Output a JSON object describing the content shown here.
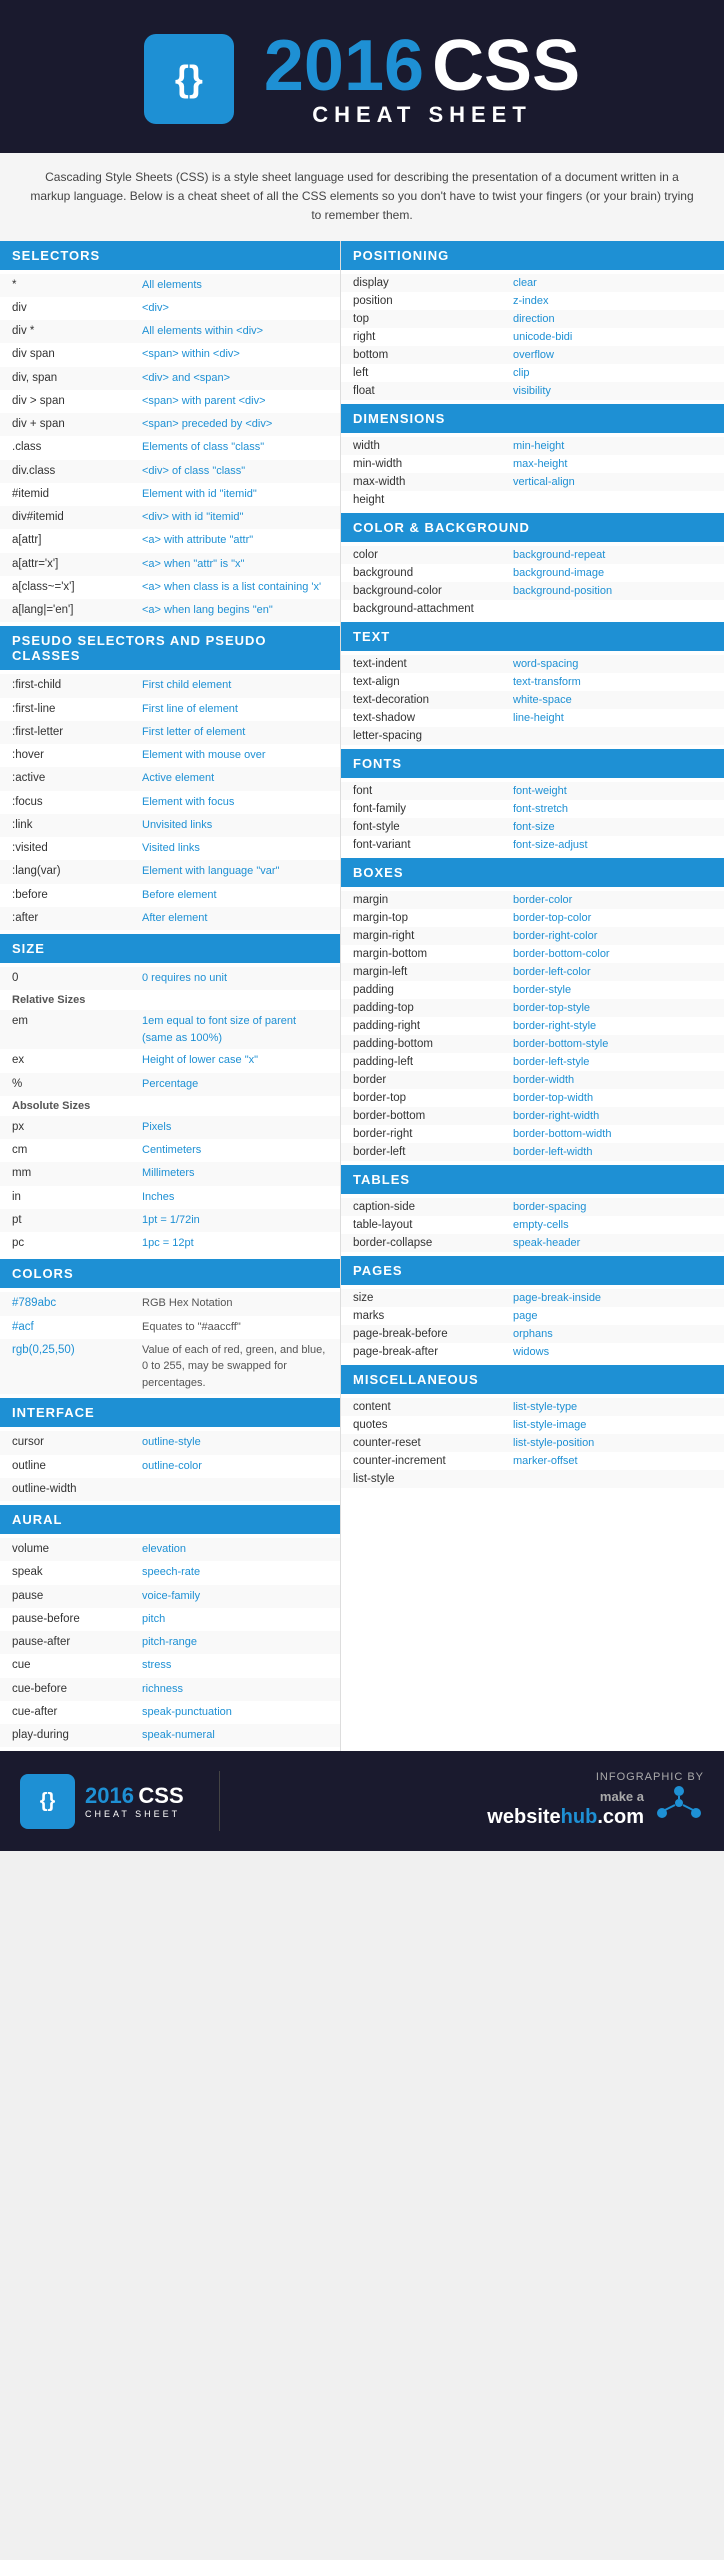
{
  "header": {
    "year": "2016",
    "css": "CSS",
    "subtitle": "CHEAT SHEET",
    "logo_symbol": "{}",
    "description": "Cascading Style Sheets (CSS) is a style sheet language used for describing the presentation of a document written in a markup language. Below is a cheat sheet of all the CSS elements so you don't have to twist your fingers (or your brain) trying to remember them."
  },
  "selectors": {
    "title": "SELECTORS",
    "rows": [
      {
        "key": "*",
        "val": "All elements"
      },
      {
        "key": "div",
        "val": "<div>"
      },
      {
        "key": "div *",
        "val": "All elements within <div>"
      },
      {
        "key": "div span",
        "val": "<span> within <div>"
      },
      {
        "key": "div, span",
        "val": "<div> and <span>"
      },
      {
        "key": "div > span",
        "val": "<span> with parent <div>"
      },
      {
        "key": "div + span",
        "val": "<span> preceded by <div>"
      },
      {
        "key": ".class",
        "val": "Elements of class \"class\""
      },
      {
        "key": "div.class",
        "val": "<div> of class \"class\""
      },
      {
        "key": "#itemid",
        "val": "Element with id \"itemid\""
      },
      {
        "key": "div#itemid",
        "val": "<div> with id \"itemid\""
      },
      {
        "key": "a[attr]",
        "val": "<a> with attribute \"attr\""
      },
      {
        "key": "a[attr='x']",
        "val": "<a> when \"attr\" is \"x\""
      },
      {
        "key": "a[class~='x']",
        "val": "<a> when class is a list containing 'x'"
      },
      {
        "key": "a[lang|='en']",
        "val": "<a> when lang begins \"en\""
      }
    ]
  },
  "pseudo": {
    "title": "PSEUDO SELECTORS AND PSEUDO CLASSES",
    "rows": [
      {
        "key": ":first-child",
        "val": "First child element"
      },
      {
        "key": ":first-line",
        "val": "First line of element"
      },
      {
        "key": ":first-letter",
        "val": "First letter of element"
      },
      {
        "key": ":hover",
        "val": "Element with mouse over"
      },
      {
        "key": ":active",
        "val": "Active element"
      },
      {
        "key": ":focus",
        "val": "Element with focus"
      },
      {
        "key": ":link",
        "val": "Unvisited links"
      },
      {
        "key": ":visited",
        "val": "Visited links"
      },
      {
        "key": ":lang(var)",
        "val": "Element with language \"var\""
      },
      {
        "key": ":before",
        "val": "Before element"
      },
      {
        "key": ":after",
        "val": "After element"
      }
    ]
  },
  "size": {
    "title": "SIZE",
    "zero": {
      "key": "0",
      "val": "0 requires no unit"
    },
    "relative_label": "Relative Sizes",
    "relative": [
      {
        "key": "em",
        "val": "1em equal to font size of parent (same as 100%)"
      },
      {
        "key": "ex",
        "val": "Height of lower case \"x\""
      },
      {
        "key": "%",
        "val": "Percentage"
      }
    ],
    "absolute_label": "Absolute Sizes",
    "absolute": [
      {
        "key": "px",
        "val": "Pixels"
      },
      {
        "key": "cm",
        "val": "Centimeters"
      },
      {
        "key": "mm",
        "val": "Millimeters"
      },
      {
        "key": "in",
        "val": "Inches"
      },
      {
        "key": "pt",
        "val": "1pt = 1/72in"
      },
      {
        "key": "pc",
        "val": "1pc = 12pt"
      }
    ]
  },
  "colors": {
    "title": "COLORS",
    "rows": [
      {
        "key": "#789abc",
        "val": "RGB Hex Notation"
      },
      {
        "key": "#acf",
        "val": "Equates to \"#aaccff\""
      },
      {
        "key": "rgb(0,25,50)",
        "val": "Value of each of red, green, and blue, 0 to 255, may be swapped for percentages."
      }
    ]
  },
  "interface": {
    "title": "INTERFACE",
    "rows": [
      {
        "key": "cursor",
        "val": "outline-style"
      },
      {
        "key": "outline",
        "val": "outline-color"
      },
      {
        "key": "outline-width",
        "val": ""
      }
    ]
  },
  "aural": {
    "title": "AURAL",
    "rows": [
      {
        "key": "volume",
        "val": "elevation"
      },
      {
        "key": "speak",
        "val": "speech-rate"
      },
      {
        "key": "pause",
        "val": "voice-family"
      },
      {
        "key": "pause-before",
        "val": "pitch"
      },
      {
        "key": "pause-after",
        "val": "pitch-range"
      },
      {
        "key": "cue",
        "val": "stress"
      },
      {
        "key": "cue-before",
        "val": "richness"
      },
      {
        "key": "cue-after",
        "val": "speak-punctuation"
      },
      {
        "key": "play-during",
        "val": "speak-numeral"
      }
    ]
  },
  "positioning": {
    "title": "POSITIONING",
    "rows": [
      {
        "key": "display",
        "val": "clear"
      },
      {
        "key": "position",
        "val": "z-index"
      },
      {
        "key": "top",
        "val": "direction"
      },
      {
        "key": "right",
        "val": "unicode-bidi"
      },
      {
        "key": "bottom",
        "val": "overflow"
      },
      {
        "key": "left",
        "val": "clip"
      },
      {
        "key": "float",
        "val": "visibility"
      }
    ]
  },
  "dimensions": {
    "title": "DIMENSIONS",
    "rows": [
      {
        "key": "width",
        "val": "min-height"
      },
      {
        "key": "min-width",
        "val": "max-height"
      },
      {
        "key": "max-width",
        "val": "vertical-align"
      },
      {
        "key": "height",
        "val": ""
      }
    ]
  },
  "color_bg": {
    "title": "COLOR & BACKGROUND",
    "rows": [
      {
        "key": "color",
        "val": "background-repeat"
      },
      {
        "key": "background",
        "val": "background-image"
      },
      {
        "key": "background-color",
        "val": "background-position"
      },
      {
        "key": "background-attachment",
        "val": ""
      }
    ]
  },
  "text": {
    "title": "TEXT",
    "rows": [
      {
        "key": "text-indent",
        "val": "word-spacing"
      },
      {
        "key": "text-align",
        "val": "text-transform"
      },
      {
        "key": "text-decoration",
        "val": "white-space"
      },
      {
        "key": "text-shadow",
        "val": "line-height"
      },
      {
        "key": "letter-spacing",
        "val": ""
      }
    ]
  },
  "fonts": {
    "title": "FONTS",
    "rows": [
      {
        "key": "font",
        "val": "font-weight"
      },
      {
        "key": "font-family",
        "val": "font-stretch"
      },
      {
        "key": "font-style",
        "val": "font-size"
      },
      {
        "key": "font-variant",
        "val": "font-size-adjust"
      }
    ]
  },
  "boxes": {
    "title": "BOXES",
    "rows": [
      {
        "key": "margin",
        "val": "border-color"
      },
      {
        "key": "margin-top",
        "val": "border-top-color"
      },
      {
        "key": "margin-right",
        "val": "border-right-color"
      },
      {
        "key": "margin-bottom",
        "val": "border-bottom-color"
      },
      {
        "key": "margin-left",
        "val": "border-left-color"
      },
      {
        "key": "padding",
        "val": "border-style"
      },
      {
        "key": "padding-top",
        "val": "border-top-style"
      },
      {
        "key": "padding-right",
        "val": "border-right-style"
      },
      {
        "key": "padding-bottom",
        "val": "border-bottom-style"
      },
      {
        "key": "padding-left",
        "val": "border-left-style"
      },
      {
        "key": "border",
        "val": "border-width"
      },
      {
        "key": "border-top",
        "val": "border-top-width"
      },
      {
        "key": "border-bottom",
        "val": "border-right-width"
      },
      {
        "key": "border-right",
        "val": "border-bottom-width"
      },
      {
        "key": "border-left",
        "val": "border-left-width"
      }
    ]
  },
  "tables": {
    "title": "TABLES",
    "rows": [
      {
        "key": "caption-side",
        "val": "border-spacing"
      },
      {
        "key": "table-layout",
        "val": "empty-cells"
      },
      {
        "key": "border-collapse",
        "val": "speak-header"
      }
    ]
  },
  "pages": {
    "title": "PAGES",
    "rows": [
      {
        "key": "size",
        "val": "page-break-inside"
      },
      {
        "key": "marks",
        "val": "page"
      },
      {
        "key": "page-break-before",
        "val": "orphans"
      },
      {
        "key": "page-break-after",
        "val": "widows"
      }
    ]
  },
  "miscellaneous": {
    "title": "MISCELLANEOUS",
    "rows": [
      {
        "key": "content",
        "val": "list-style-type"
      },
      {
        "key": "quotes",
        "val": "list-style-image"
      },
      {
        "key": "counter-reset",
        "val": "list-style-position"
      },
      {
        "key": "counter-increment",
        "val": "marker-offset"
      },
      {
        "key": "list-style",
        "val": ""
      }
    ]
  },
  "footer": {
    "logo_symbol": "{}",
    "year": "2016",
    "css": "CSS",
    "subtitle": "CHEAT SHEET",
    "infographic_by": "INFOGRAPHIC BY",
    "website": "make a websitehub.com"
  }
}
